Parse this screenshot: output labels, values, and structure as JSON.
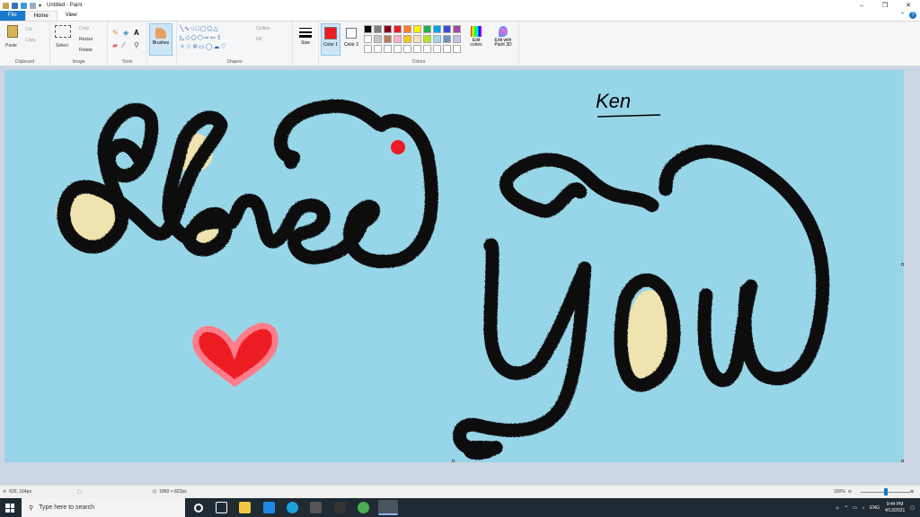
{
  "window": {
    "title": "Untitled - Paint",
    "minimize": "–",
    "maximize": "❐",
    "close": "✕"
  },
  "tabs": [
    {
      "label": "File"
    },
    {
      "label": "Home"
    },
    {
      "label": "View"
    }
  ],
  "ribbon": {
    "clipboard": {
      "label": "Clipboard",
      "paste": "Paste",
      "cut": "Cut",
      "copy": "Copy"
    },
    "image": {
      "label": "Image",
      "select": "Select",
      "crop": "Crop",
      "resize": "Resize",
      "rotate": "Rotate"
    },
    "tools": {
      "label": "Tools"
    },
    "brushes": {
      "label": "Brushes"
    },
    "shapes": {
      "label": "Shapes",
      "outline": "Outline",
      "fill": "Fill"
    },
    "size": {
      "label": "Size"
    },
    "colors": {
      "label": "Colors",
      "color1": "Color 1",
      "color2": "Color 2",
      "edit_colors": "Edit colors",
      "edit_paint3d": "Edit with Paint 3D",
      "color1_value": "#ed1c24",
      "color2_value": "#ffffff",
      "palette_row1": [
        "#000000",
        "#7f7f7f",
        "#880015",
        "#ed1c24",
        "#ff7f27",
        "#fff200",
        "#22b14c",
        "#00a2e8",
        "#3f48cc",
        "#a349a4"
      ],
      "palette_row2": [
        "#ffffff",
        "#c3c3c3",
        "#b97a57",
        "#ffaec9",
        "#ffc90e",
        "#efe4b0",
        "#b5e61d",
        "#99d9ea",
        "#7092be",
        "#c8bfe7"
      ]
    }
  },
  "canvas": {
    "background": "#97d6e9",
    "signature": "Ken"
  },
  "status": {
    "cursor_pos": "626, 164px",
    "canvas_size": "1860 × 822px",
    "zoom": "100%"
  },
  "taskbar": {
    "search_placeholder": "Type here to search",
    "lang": "ENG",
    "time": "9:44 PM",
    "date": "4/13/2021"
  }
}
